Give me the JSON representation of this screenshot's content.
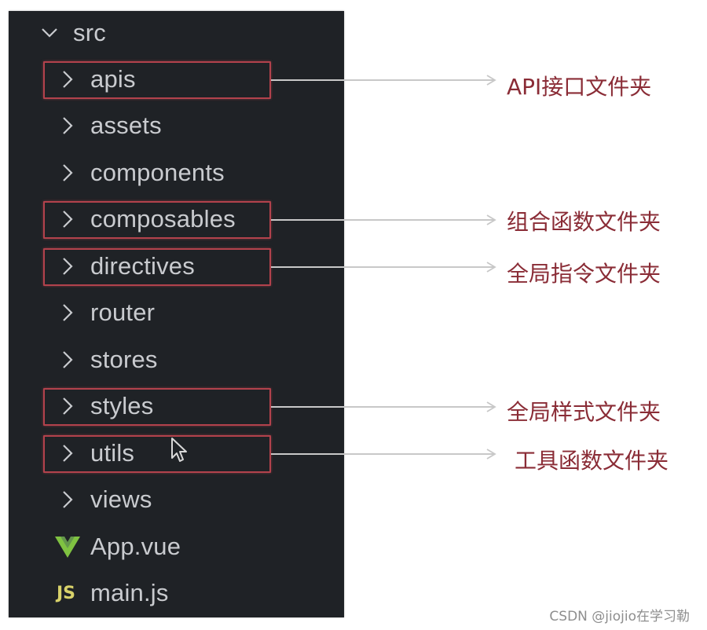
{
  "explorer": {
    "root": {
      "name": "src",
      "expanded": true,
      "icon": "chevron-down-icon"
    },
    "items": [
      {
        "name": "apis",
        "type": "folder",
        "icon": "chevron-right-icon",
        "highlighted": true,
        "annotation": "API接口文件夹"
      },
      {
        "name": "assets",
        "type": "folder",
        "icon": "chevron-right-icon",
        "highlighted": false
      },
      {
        "name": "components",
        "type": "folder",
        "icon": "chevron-right-icon",
        "highlighted": false
      },
      {
        "name": "composables",
        "type": "folder",
        "icon": "chevron-right-icon",
        "highlighted": true,
        "annotation": "组合函数文件夹"
      },
      {
        "name": "directives",
        "type": "folder",
        "icon": "chevron-right-icon",
        "highlighted": true,
        "annotation": "全局指令文件夹"
      },
      {
        "name": "router",
        "type": "folder",
        "icon": "chevron-right-icon",
        "highlighted": false
      },
      {
        "name": "stores",
        "type": "folder",
        "icon": "chevron-right-icon",
        "highlighted": false
      },
      {
        "name": "styles",
        "type": "folder",
        "icon": "chevron-right-icon",
        "highlighted": true,
        "annotation": "全局样式文件夹"
      },
      {
        "name": "utils",
        "type": "folder",
        "icon": "chevron-right-icon",
        "highlighted": true,
        "annotation": "工具函数文件夹"
      },
      {
        "name": "views",
        "type": "folder",
        "icon": "chevron-right-icon",
        "highlighted": false
      },
      {
        "name": "App.vue",
        "type": "file",
        "icon": "vue-file-icon",
        "highlighted": false
      },
      {
        "name": "main.js",
        "type": "file",
        "icon": "js-file-icon",
        "highlighted": false
      }
    ]
  },
  "colors": {
    "panel_bg": "#1f2226",
    "text": "#c9cbcf",
    "highlight_border": "#b2424c",
    "annotation_text": "#8a2c36",
    "connector": "#c8c8c8",
    "vue_green": "#7fc241",
    "js_yellow": "#d8d26a"
  },
  "js_badge": "JS",
  "watermark": "CSDN @jiojio在学习勒"
}
